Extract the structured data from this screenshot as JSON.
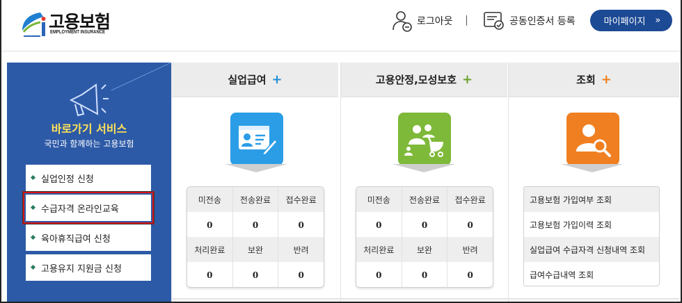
{
  "header": {
    "logo_title": "고용보험",
    "logo_subtitle": "EMPLOYMENT INSURANCE",
    "logout_label": "로그아웃",
    "separator": "|",
    "cert_label": "공동인증서 등록",
    "mypage_label": "마이페이지",
    "mypage_arrow": "»"
  },
  "quick": {
    "title": "바로가기 서비스",
    "subtitle": "국민과 함께하는 고용보험",
    "items": [
      {
        "label": "실업인정 신청"
      },
      {
        "label": "수급자격 온라인교육"
      },
      {
        "label": "육아휴직급여 신청"
      },
      {
        "label": "고용유지 지원금 신청"
      }
    ]
  },
  "columns": [
    {
      "title": "실업급여",
      "plus": "+",
      "plus_color": "#1f8fd6",
      "icon": "id-card-icon",
      "icon_color": "#2a9de6",
      "headers1": [
        "미전송",
        "전송완료",
        "접수완료"
      ],
      "values1": [
        "0",
        "0",
        "0"
      ],
      "headers2": [
        "처리완료",
        "보완",
        "반려"
      ],
      "values2": [
        "0",
        "0",
        "0"
      ]
    },
    {
      "title": "고용안정,모성보호",
      "plus": "+",
      "plus_color": "#6aa22b",
      "icon": "family-stroller-icon",
      "icon_color": "#7fb93a",
      "headers1": [
        "미전송",
        "전송완료",
        "접수완료"
      ],
      "values1": [
        "0",
        "0",
        "0"
      ],
      "headers2": [
        "처리완료",
        "보완",
        "반려"
      ],
      "values2": [
        "0",
        "0",
        "0"
      ]
    },
    {
      "title": "조회",
      "plus": "+",
      "plus_color": "#ef7d1a",
      "icon": "user-search-icon",
      "icon_color": "#f07f22",
      "items": [
        {
          "label": "고용보험 가입여부 조회"
        },
        {
          "label": "고용보험 가입이력 조회"
        },
        {
          "label": "실업급여 수급자격 신청내역 조회"
        },
        {
          "label": "급여수급내역 조회"
        }
      ]
    }
  ]
}
